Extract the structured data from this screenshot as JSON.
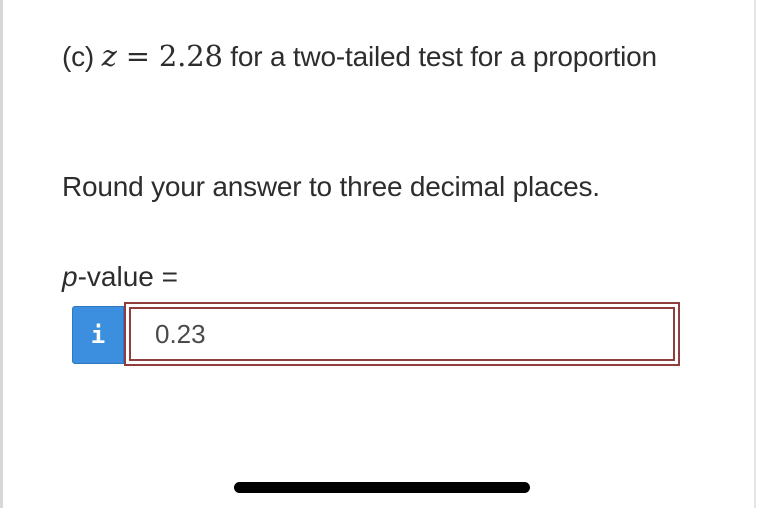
{
  "question": {
    "part_label": "(c)",
    "variable": "z",
    "equals": "=",
    "value": "2.28",
    "text": "for a two-tailed test for a proportion"
  },
  "instruction": "Round your answer to three decimal places.",
  "answer": {
    "variable": "p",
    "label_suffix": "-value =",
    "info_icon": "i",
    "input_value": "0.23"
  },
  "colors": {
    "info_button": "#3b8fde",
    "input_border": "#8f3d3d"
  }
}
